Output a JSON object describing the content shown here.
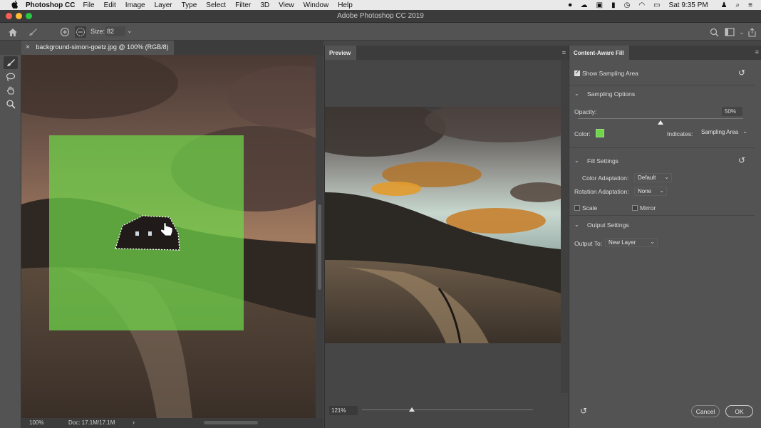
{
  "menubar": {
    "apple": "",
    "app_name": "Photoshop CC",
    "items": [
      "File",
      "Edit",
      "Image",
      "Layer",
      "Type",
      "Select",
      "Filter",
      "3D",
      "View",
      "Window",
      "Help"
    ],
    "clock": "Sat 9:35 PM"
  },
  "window": {
    "title": "Adobe Photoshop CC 2019"
  },
  "options": {
    "size_label": "Size:",
    "size_value": "82"
  },
  "document": {
    "tab_close": "×",
    "tab_title": "background-simon-goetz.jpg @ 100% (RGB/8)",
    "zoom": "100%",
    "doc_info": "Doc: 17.1M/17.1M",
    "info_arrow": "›"
  },
  "preview": {
    "tab": "Preview",
    "zoom": "121%",
    "zoom_level": 0.29
  },
  "caf": {
    "tab": "Content-Aware Fill",
    "show_sampling_area": {
      "label": "Show Sampling Area",
      "checked": true
    },
    "sampling_options": {
      "title": "Sampling Options",
      "opacity_label": "Opacity:",
      "opacity_value": "50%",
      "opacity_level": 0.5,
      "color_label": "Color:",
      "color": "#6fd64a",
      "indicates_label": "Indicates:",
      "indicates_value": "Sampling Area"
    },
    "fill_settings": {
      "title": "Fill Settings",
      "color_adaptation_label": "Color Adaptation:",
      "color_adaptation_value": "Default",
      "rotation_adaptation_label": "Rotation Adaptation:",
      "rotation_adaptation_value": "None",
      "scale_label": "Scale",
      "scale_checked": false,
      "mirror_label": "Mirror",
      "mirror_checked": false
    },
    "output_settings": {
      "title": "Output Settings",
      "output_to_label": "Output To:",
      "output_to_value": "New Layer"
    },
    "cancel_label": "Cancel",
    "ok_label": "OK"
  }
}
